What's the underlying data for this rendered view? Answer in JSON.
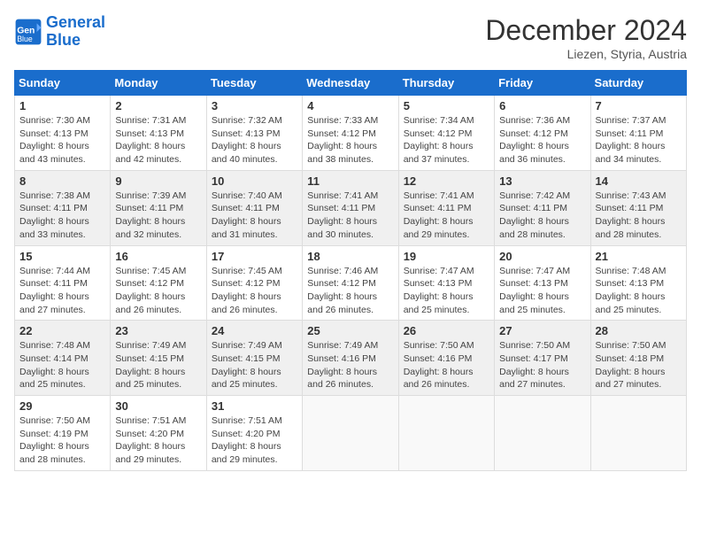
{
  "header": {
    "logo_line1": "General",
    "logo_line2": "Blue",
    "month": "December 2024",
    "location": "Liezen, Styria, Austria"
  },
  "days_of_week": [
    "Sunday",
    "Monday",
    "Tuesday",
    "Wednesday",
    "Thursday",
    "Friday",
    "Saturday"
  ],
  "weeks": [
    [
      {
        "day": "1",
        "sunrise": "Sunrise: 7:30 AM",
        "sunset": "Sunset: 4:13 PM",
        "daylight": "Daylight: 8 hours and 43 minutes."
      },
      {
        "day": "2",
        "sunrise": "Sunrise: 7:31 AM",
        "sunset": "Sunset: 4:13 PM",
        "daylight": "Daylight: 8 hours and 42 minutes."
      },
      {
        "day": "3",
        "sunrise": "Sunrise: 7:32 AM",
        "sunset": "Sunset: 4:13 PM",
        "daylight": "Daylight: 8 hours and 40 minutes."
      },
      {
        "day": "4",
        "sunrise": "Sunrise: 7:33 AM",
        "sunset": "Sunset: 4:12 PM",
        "daylight": "Daylight: 8 hours and 38 minutes."
      },
      {
        "day": "5",
        "sunrise": "Sunrise: 7:34 AM",
        "sunset": "Sunset: 4:12 PM",
        "daylight": "Daylight: 8 hours and 37 minutes."
      },
      {
        "day": "6",
        "sunrise": "Sunrise: 7:36 AM",
        "sunset": "Sunset: 4:12 PM",
        "daylight": "Daylight: 8 hours and 36 minutes."
      },
      {
        "day": "7",
        "sunrise": "Sunrise: 7:37 AM",
        "sunset": "Sunset: 4:11 PM",
        "daylight": "Daylight: 8 hours and 34 minutes."
      }
    ],
    [
      {
        "day": "8",
        "sunrise": "Sunrise: 7:38 AM",
        "sunset": "Sunset: 4:11 PM",
        "daylight": "Daylight: 8 hours and 33 minutes."
      },
      {
        "day": "9",
        "sunrise": "Sunrise: 7:39 AM",
        "sunset": "Sunset: 4:11 PM",
        "daylight": "Daylight: 8 hours and 32 minutes."
      },
      {
        "day": "10",
        "sunrise": "Sunrise: 7:40 AM",
        "sunset": "Sunset: 4:11 PM",
        "daylight": "Daylight: 8 hours and 31 minutes."
      },
      {
        "day": "11",
        "sunrise": "Sunrise: 7:41 AM",
        "sunset": "Sunset: 4:11 PM",
        "daylight": "Daylight: 8 hours and 30 minutes."
      },
      {
        "day": "12",
        "sunrise": "Sunrise: 7:41 AM",
        "sunset": "Sunset: 4:11 PM",
        "daylight": "Daylight: 8 hours and 29 minutes."
      },
      {
        "day": "13",
        "sunrise": "Sunrise: 7:42 AM",
        "sunset": "Sunset: 4:11 PM",
        "daylight": "Daylight: 8 hours and 28 minutes."
      },
      {
        "day": "14",
        "sunrise": "Sunrise: 7:43 AM",
        "sunset": "Sunset: 4:11 PM",
        "daylight": "Daylight: 8 hours and 28 minutes."
      }
    ],
    [
      {
        "day": "15",
        "sunrise": "Sunrise: 7:44 AM",
        "sunset": "Sunset: 4:11 PM",
        "daylight": "Daylight: 8 hours and 27 minutes."
      },
      {
        "day": "16",
        "sunrise": "Sunrise: 7:45 AM",
        "sunset": "Sunset: 4:12 PM",
        "daylight": "Daylight: 8 hours and 26 minutes."
      },
      {
        "day": "17",
        "sunrise": "Sunrise: 7:45 AM",
        "sunset": "Sunset: 4:12 PM",
        "daylight": "Daylight: 8 hours and 26 minutes."
      },
      {
        "day": "18",
        "sunrise": "Sunrise: 7:46 AM",
        "sunset": "Sunset: 4:12 PM",
        "daylight": "Daylight: 8 hours and 26 minutes."
      },
      {
        "day": "19",
        "sunrise": "Sunrise: 7:47 AM",
        "sunset": "Sunset: 4:13 PM",
        "daylight": "Daylight: 8 hours and 25 minutes."
      },
      {
        "day": "20",
        "sunrise": "Sunrise: 7:47 AM",
        "sunset": "Sunset: 4:13 PM",
        "daylight": "Daylight: 8 hours and 25 minutes."
      },
      {
        "day": "21",
        "sunrise": "Sunrise: 7:48 AM",
        "sunset": "Sunset: 4:13 PM",
        "daylight": "Daylight: 8 hours and 25 minutes."
      }
    ],
    [
      {
        "day": "22",
        "sunrise": "Sunrise: 7:48 AM",
        "sunset": "Sunset: 4:14 PM",
        "daylight": "Daylight: 8 hours and 25 minutes."
      },
      {
        "day": "23",
        "sunrise": "Sunrise: 7:49 AM",
        "sunset": "Sunset: 4:15 PM",
        "daylight": "Daylight: 8 hours and 25 minutes."
      },
      {
        "day": "24",
        "sunrise": "Sunrise: 7:49 AM",
        "sunset": "Sunset: 4:15 PM",
        "daylight": "Daylight: 8 hours and 25 minutes."
      },
      {
        "day": "25",
        "sunrise": "Sunrise: 7:49 AM",
        "sunset": "Sunset: 4:16 PM",
        "daylight": "Daylight: 8 hours and 26 minutes."
      },
      {
        "day": "26",
        "sunrise": "Sunrise: 7:50 AM",
        "sunset": "Sunset: 4:16 PM",
        "daylight": "Daylight: 8 hours and 26 minutes."
      },
      {
        "day": "27",
        "sunrise": "Sunrise: 7:50 AM",
        "sunset": "Sunset: 4:17 PM",
        "daylight": "Daylight: 8 hours and 27 minutes."
      },
      {
        "day": "28",
        "sunrise": "Sunrise: 7:50 AM",
        "sunset": "Sunset: 4:18 PM",
        "daylight": "Daylight: 8 hours and 27 minutes."
      }
    ],
    [
      {
        "day": "29",
        "sunrise": "Sunrise: 7:50 AM",
        "sunset": "Sunset: 4:19 PM",
        "daylight": "Daylight: 8 hours and 28 minutes."
      },
      {
        "day": "30",
        "sunrise": "Sunrise: 7:51 AM",
        "sunset": "Sunset: 4:20 PM",
        "daylight": "Daylight: 8 hours and 29 minutes."
      },
      {
        "day": "31",
        "sunrise": "Sunrise: 7:51 AM",
        "sunset": "Sunset: 4:20 PM",
        "daylight": "Daylight: 8 hours and 29 minutes."
      },
      null,
      null,
      null,
      null
    ]
  ]
}
